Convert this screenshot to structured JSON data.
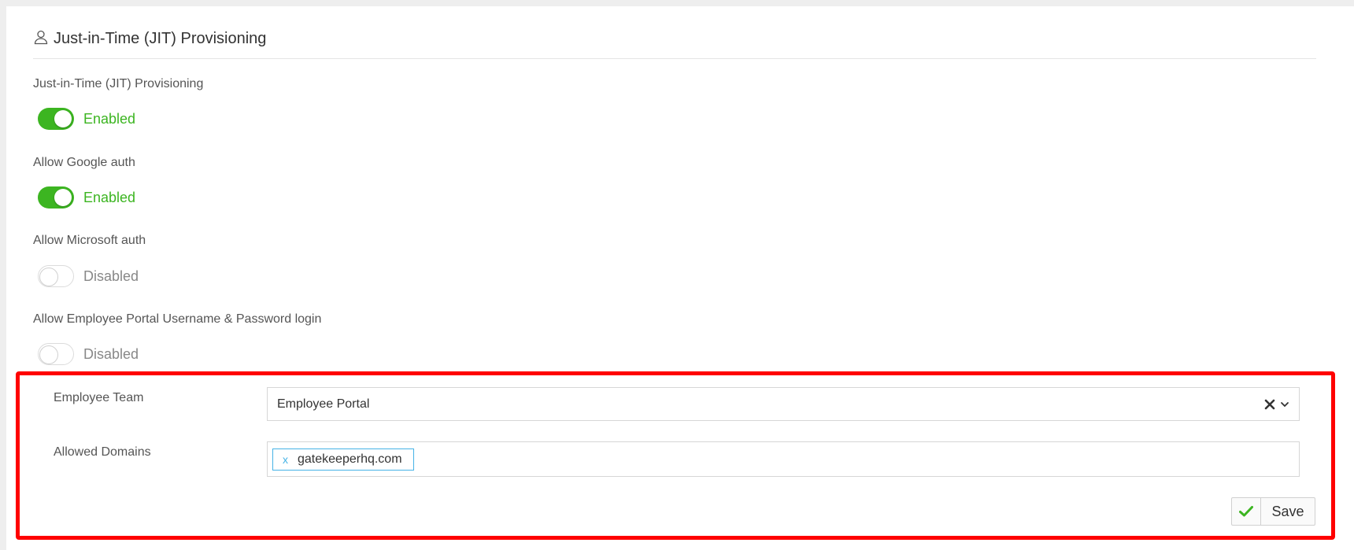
{
  "section": {
    "title": "Just-in-Time (JIT) Provisioning",
    "icon": "user-icon"
  },
  "settings": [
    {
      "label": "Just-in-Time (JIT) Provisioning",
      "enabled": true,
      "state_text": "Enabled"
    },
    {
      "label": "Allow Google auth",
      "enabled": true,
      "state_text": "Enabled"
    },
    {
      "label": "Allow Microsoft auth",
      "enabled": false,
      "state_text": "Disabled"
    },
    {
      "label": "Allow Employee Portal Username & Password login",
      "enabled": false,
      "state_text": "Disabled"
    }
  ],
  "employee_team": {
    "label": "Employee Team",
    "value": "Employee Portal"
  },
  "allowed_domains": {
    "label": "Allowed Domains",
    "tags": [
      {
        "remove": "x",
        "text": "gatekeeperhq.com"
      }
    ]
  },
  "save_button": {
    "label": "Save"
  },
  "colors": {
    "enabled": "#3cb521",
    "disabled": "#888888",
    "highlight": "#ff0000",
    "tag_border": "#46b3e6"
  }
}
